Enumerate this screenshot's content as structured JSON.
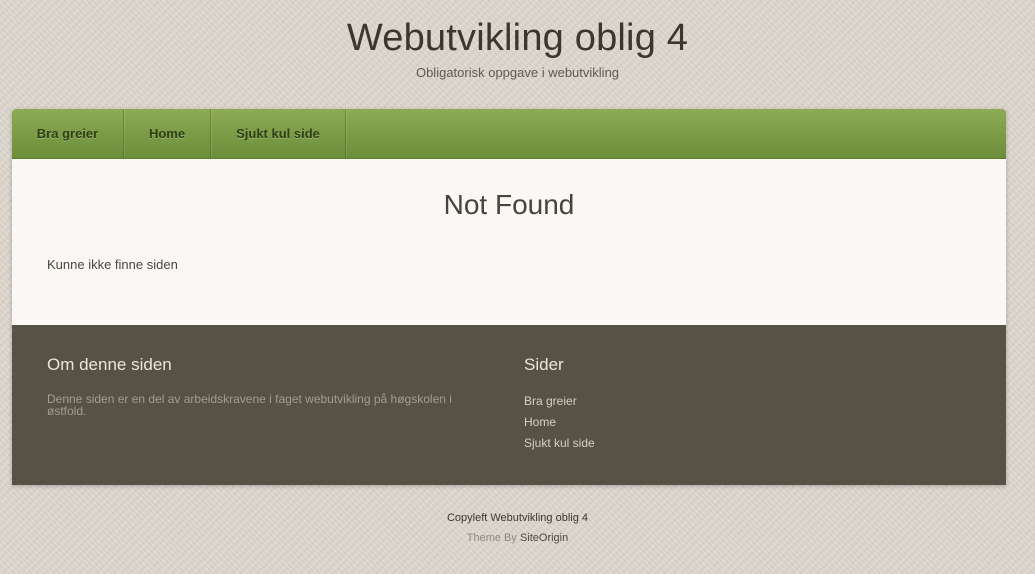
{
  "header": {
    "title": "Webutvikling oblig 4",
    "tagline": "Obligatorisk oppgave i webutvikling"
  },
  "nav": {
    "items": [
      {
        "label": "Bra greier"
      },
      {
        "label": "Home"
      },
      {
        "label": "Sjukt kul side"
      }
    ]
  },
  "main": {
    "title": "Not Found",
    "message": "Kunne ikke finne siden"
  },
  "footer": {
    "about": {
      "title": "Om denne siden",
      "text": "Denne siden er en del av arbeidskravene i faget webutvikling på høgskolen i østfold."
    },
    "pages": {
      "title": "Sider",
      "items": [
        {
          "label": "Bra greier"
        },
        {
          "label": "Home"
        },
        {
          "label": "Sjukt kul side"
        }
      ]
    }
  },
  "credits": {
    "copyleft": "Copyleft Webutvikling oblig 4",
    "theme_prefix": "Theme By ",
    "theme_link": "SiteOrigin"
  }
}
